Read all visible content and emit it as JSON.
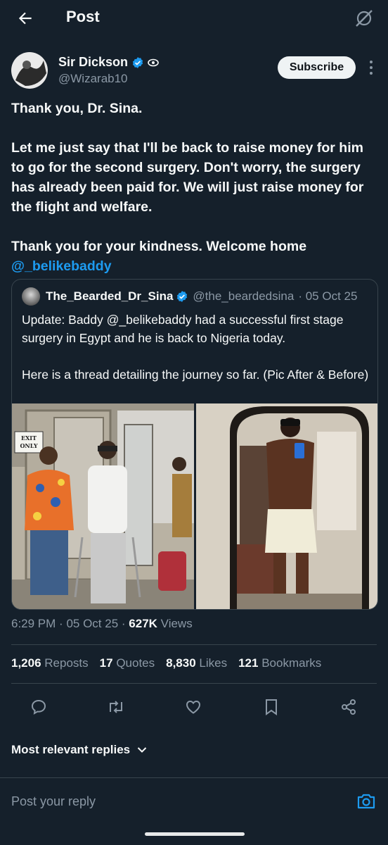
{
  "header": {
    "title": "Post"
  },
  "author": {
    "name": "Sir Dickson",
    "handle": "@Wizarab10",
    "badge": "eye-icon"
  },
  "subscribe_label": "Subscribe",
  "post": {
    "line1": "Thank you, Dr. Sina.",
    "line2": "Let me just say that I'll be back to raise money for him to go for the second surgery. Don't worry, the surgery has already been paid for. We will just raise money for the flight and welfare.",
    "line3": "Thank you for your kindness. Welcome home",
    "mention": "@_belikebaddy"
  },
  "quote": {
    "name": "The_Bearded_Dr_Sina",
    "handle": "@the_beardedsina",
    "date": "· 05 Oct 25",
    "text_before": "Update: Baddy ",
    "text_mention": "@_belikebaddy",
    "text_after": " had a successful first stage surgery in Egypt and he is back to Nigeria today.",
    "text2": "Here is a thread detailing the journey so far. (Pic After & Before)",
    "sign_text": "EXIT ONLY"
  },
  "meta": {
    "time": "6:29 PM",
    "date": "05 Oct 25",
    "views": "627K",
    "views_label": "Views"
  },
  "stats": [
    {
      "count": "1,206",
      "label": "Reposts"
    },
    {
      "count": "17",
      "label": "Quotes"
    },
    {
      "count": "8,830",
      "label": "Likes"
    },
    {
      "count": "121",
      "label": "Bookmarks"
    }
  ],
  "replies_sort": "Most relevant replies",
  "reply": {
    "placeholder": "Post your reply"
  },
  "colors": {
    "background": "#15202b",
    "accent": "#1d9bf0",
    "muted": "#8b98a5",
    "border": "#38444d"
  }
}
